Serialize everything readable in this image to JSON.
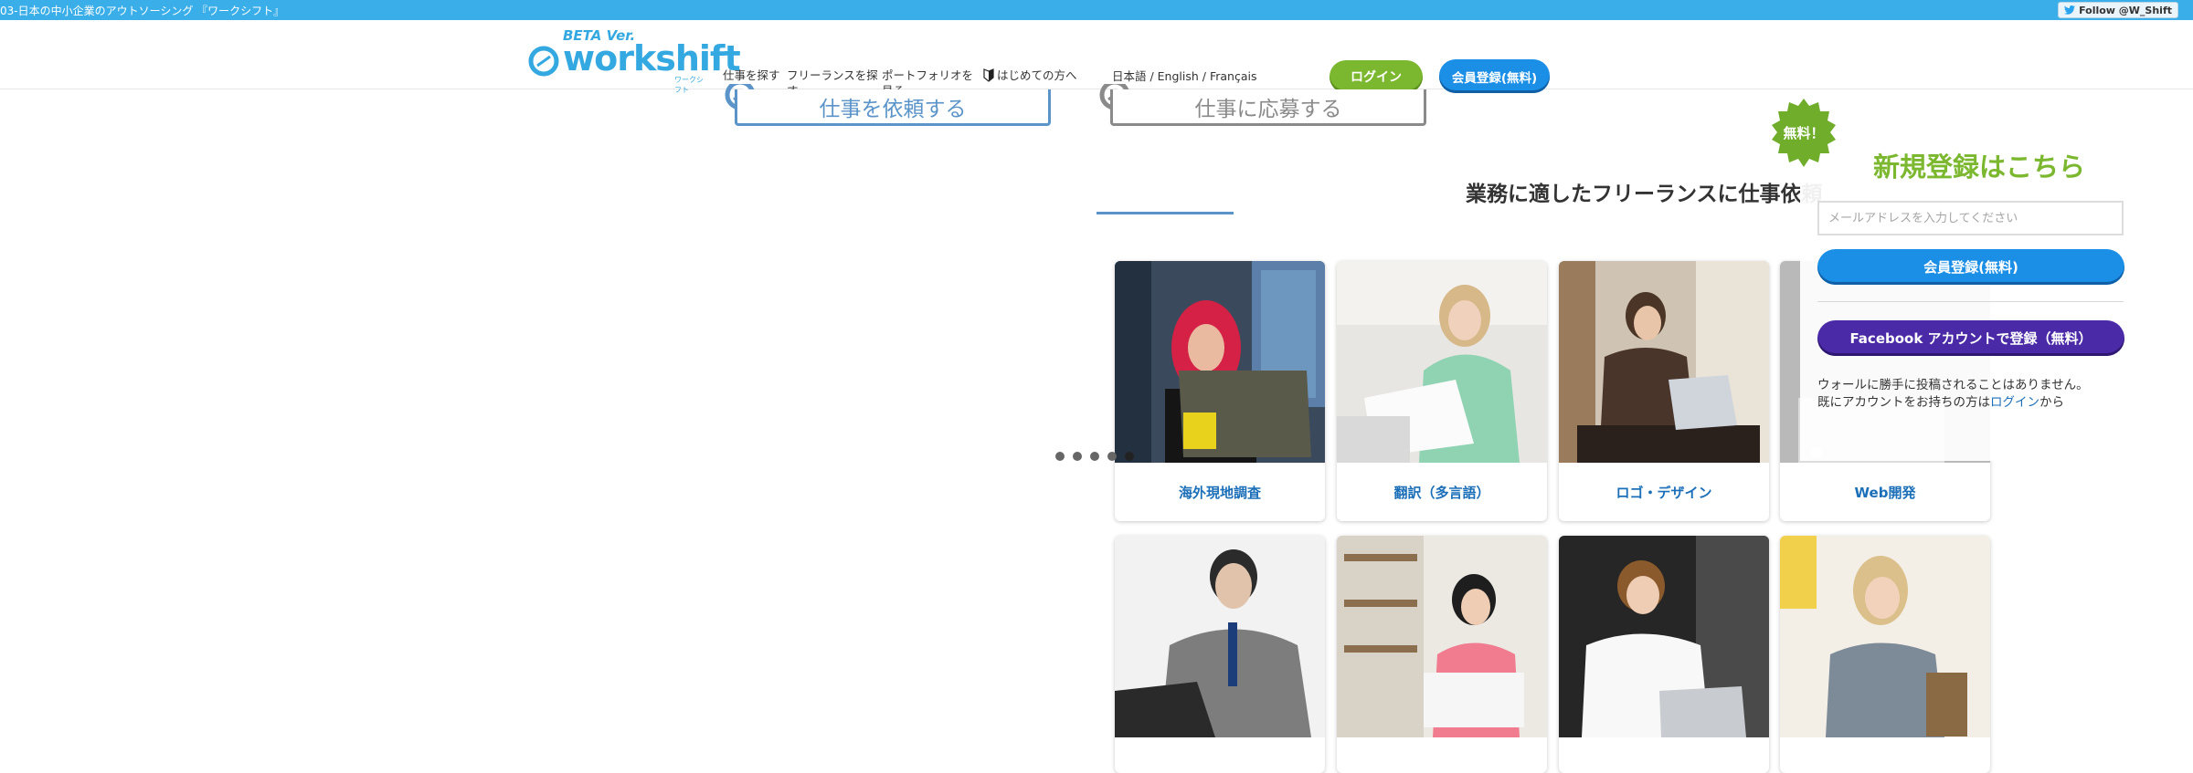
{
  "top_bar": {
    "tagline": "03-日本の中小企業のアウトソーシング 『ワークシフト』",
    "follow_label": "Follow @W_Shift"
  },
  "logo": {
    "beta": "BETA Ver.",
    "word": "workshift",
    "kana": "ワークシフト"
  },
  "nav": {
    "find_jobs": "仕事を探す",
    "find_freelancers": "フリーランスを探す",
    "portfolio": "ポートフォリオを見る",
    "first_time": "はじめての方へ",
    "languages": "日本語 / English / Français"
  },
  "header_buttons": {
    "login": "ログイン",
    "register": "会員登録(無料)"
  },
  "tabs": {
    "request": "仕事を依頼する",
    "apply": "仕事に応募する"
  },
  "section": {
    "title": "業務に適したフリーランスに仕事依頼"
  },
  "categories": [
    {
      "label": "海外現地調査"
    },
    {
      "label": "翻訳（多言語）"
    },
    {
      "label": "ロゴ・デザイン"
    },
    {
      "label": "Web開発"
    }
  ],
  "carousel": {
    "dot_count": 5,
    "active_index": 4
  },
  "register_panel": {
    "badge": "無料！",
    "title": "新規登録はこちら",
    "email_placeholder": "メールアドレスを入力してください",
    "register_button": "会員登録(無料)",
    "facebook_button": "Facebook アカウントで登録（無料）",
    "note_line1": "ウォールに勝手に投稿されることはありません。",
    "note_line2_prefix": "既にアカウントをお持ちの方は",
    "note_line2_link": "ログイン",
    "note_line2_suffix": "から"
  },
  "colors": {
    "brand_blue": "#34a8e0",
    "topbar": "#3aaee8",
    "login_green": "#7cb82f",
    "register_blue": "#1b8fe6",
    "facebook_purple": "#4a2aa6",
    "link_blue": "#1b6fb8"
  }
}
